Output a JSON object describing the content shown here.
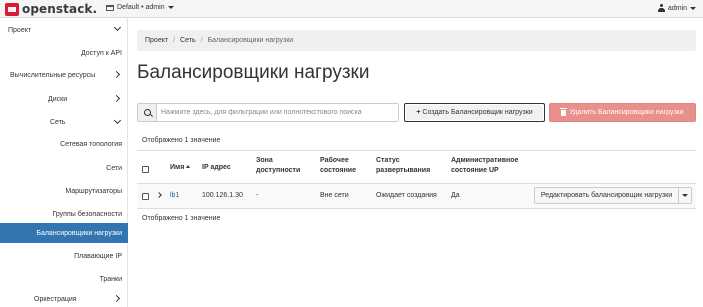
{
  "topbar": {
    "logo_text": "openstack.",
    "project_picker": "Default • admin",
    "user": "admin"
  },
  "sidebar": {
    "items": [
      {
        "label": "Проект",
        "type": "section",
        "icon": "chevron-down-icon"
      },
      {
        "label": "Доступ к API",
        "type": "leaf"
      },
      {
        "label": "Вычислительные ресурсы",
        "type": "group",
        "icon": "chevron-right-icon"
      },
      {
        "label": "Диски",
        "type": "group",
        "icon": "chevron-right-icon"
      },
      {
        "label": "Сеть",
        "type": "group",
        "icon": "chevron-down-icon"
      },
      {
        "label": "Сетевая топология",
        "type": "leaf"
      },
      {
        "label": "Сети",
        "type": "leaf"
      },
      {
        "label": "Маршрутизаторы",
        "type": "leaf"
      },
      {
        "label": "Группы безопасности",
        "type": "leaf"
      },
      {
        "label": "Балансировщики нагрузки",
        "type": "leaf",
        "active": true
      },
      {
        "label": "Плавающие IP",
        "type": "leaf"
      },
      {
        "label": "Транки",
        "type": "leaf"
      },
      {
        "label": "Оркестрация",
        "type": "group",
        "icon": "chevron-right-icon"
      }
    ],
    "active_color": "#3276b1"
  },
  "breadcrumb": {
    "items": [
      "Проект",
      "Сеть",
      "Балансировщики нагрузки"
    ],
    "separator": "/"
  },
  "page": {
    "title": "Балансировщики нагрузки"
  },
  "toolbar": {
    "filter_placeholder": "Нажмите здесь, для фильтрации или полнотекстового поиска",
    "create_label": "Создать Балансировщик нагрузки",
    "delete_label": "Удалить Балансировщики нагрузки",
    "delete_color": "#e8908b"
  },
  "table": {
    "count_top": "Отображено 1 значение",
    "count_bottom": "Отображено 1 значение",
    "headers": {
      "name": "Имя",
      "ip": "IP адрес",
      "zone": [
        "Зона",
        "доступности"
      ],
      "operating": [
        "Рабочее",
        "состояние"
      ],
      "provisioning": [
        "Статус",
        "развертывания"
      ],
      "admin_state": [
        "Административное",
        "состояние UP"
      ]
    },
    "rows": [
      {
        "name": "lb1",
        "ip": "100.126.1.30",
        "zone": "-",
        "operating": "Вне сети",
        "provisioning": "Ожидает создания",
        "admin_state": "Да",
        "action": "Редактировать балансировщик нагрузки"
      }
    ]
  }
}
